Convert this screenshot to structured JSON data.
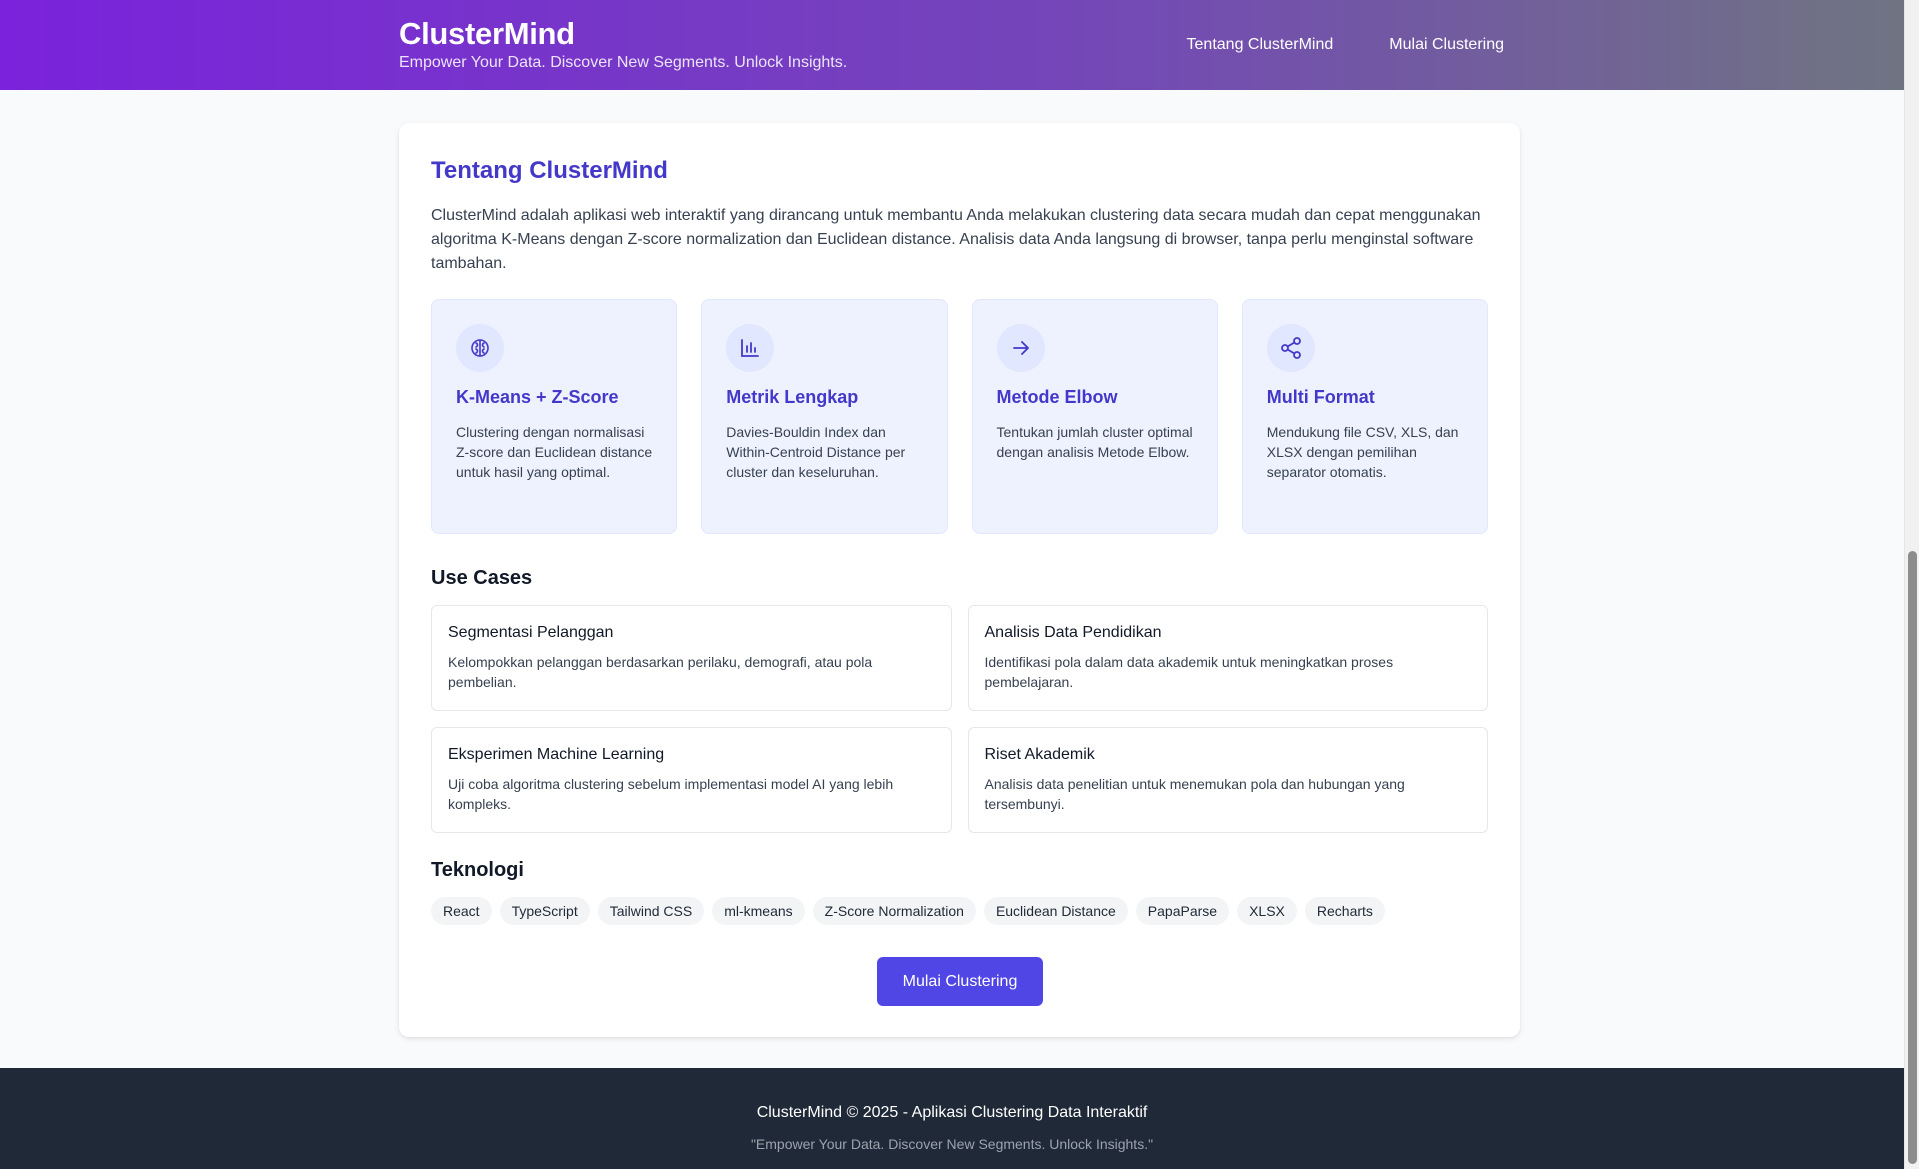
{
  "header": {
    "title": "ClusterMind",
    "tagline": "Empower Your Data. Discover New Segments. Unlock Insights.",
    "nav": [
      "Tentang ClusterMind",
      "Mulai Clustering"
    ]
  },
  "about": {
    "title": "Tentang ClusterMind",
    "intro": "ClusterMind adalah aplikasi web interaktif yang dirancang untuk membantu Anda melakukan clustering data secara mudah dan cepat menggunakan algoritma K-Means dengan Z-score normalization dan Euclidean distance. Analisis data Anda langsung di browser, tanpa perlu menginstal software tambahan.",
    "features": [
      {
        "icon": "brain-icon",
        "title": "K-Means + Z-Score",
        "desc": "Clustering dengan normalisasi Z-score dan Euclidean distance untuk hasil yang optimal."
      },
      {
        "icon": "bar-chart-icon",
        "title": "Metrik Lengkap",
        "desc": "Davies-Bouldin Index dan Within-Centroid Distance per cluster dan keseluruhan."
      },
      {
        "icon": "arrow-right-icon",
        "title": "Metode Elbow",
        "desc": "Tentukan jumlah cluster optimal dengan analisis Metode Elbow."
      },
      {
        "icon": "share-icon",
        "title": "Multi Format",
        "desc": "Mendukung file CSV, XLS, dan XLSX dengan pemilihan separator otomatis."
      }
    ]
  },
  "use_cases": {
    "heading": "Use Cases",
    "items": [
      {
        "title": "Segmentasi Pelanggan",
        "desc": "Kelompokkan pelanggan berdasarkan perilaku, demografi, atau pola pembelian."
      },
      {
        "title": "Analisis Data Pendidikan",
        "desc": "Identifikasi pola dalam data akademik untuk meningkatkan proses pembelajaran."
      },
      {
        "title": "Eksperimen Machine Learning",
        "desc": "Uji coba algoritma clustering sebelum implementasi model AI yang lebih kompleks."
      },
      {
        "title": "Riset Akademik",
        "desc": "Analisis data penelitian untuk menemukan pola dan hubungan yang tersembunyi."
      }
    ]
  },
  "tech": {
    "heading": "Teknologi",
    "items": [
      "React",
      "TypeScript",
      "Tailwind CSS",
      "ml-kmeans",
      "Z-Score Normalization",
      "Euclidean Distance",
      "PapaParse",
      "XLSX",
      "Recharts"
    ]
  },
  "cta_label": "Mulai Clustering",
  "footer": {
    "main": "ClusterMind © 2025 - Aplikasi Clustering Data Interaktif",
    "sub": "\"Empower Your Data. Discover New Segments. Unlock Insights.\""
  },
  "colors": {
    "accent": "#4338ca",
    "button": "#4f46e5",
    "header_start": "#7a22dc",
    "header_end": "#6f7581",
    "footer_bg": "#1f2937"
  }
}
